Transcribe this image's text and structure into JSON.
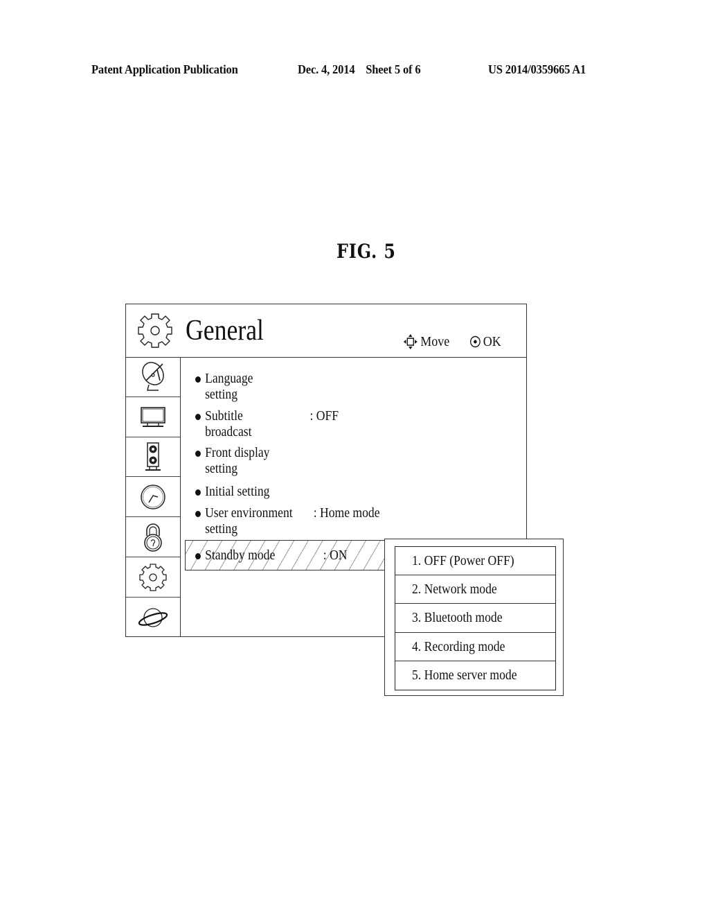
{
  "header": {
    "publication": "Patent Application Publication",
    "date_sheet": "Dec. 4, 2014    Sheet 5 of 6",
    "patent_number": "US 2014/0359665 A1"
  },
  "figure": {
    "label": "FIG. 5"
  },
  "settings_menu": {
    "title": "General",
    "title_icon": "gear-icon",
    "hints": [
      {
        "icon": "four-way-arrow-icon",
        "label": "Move"
      },
      {
        "icon": "ok-circle-icon",
        "label": "OK"
      }
    ],
    "sidebar": [
      {
        "icon": "satellite-dish-icon",
        "name": "broadcast"
      },
      {
        "icon": "tv-monitor-icon",
        "name": "picture"
      },
      {
        "icon": "speaker-icon",
        "name": "audio"
      },
      {
        "icon": "clock-icon",
        "name": "time"
      },
      {
        "icon": "padlock-icon",
        "name": "lock"
      },
      {
        "icon": "gear-icon",
        "name": "general"
      },
      {
        "icon": "planet-icon",
        "name": "network"
      }
    ],
    "items": [
      {
        "label_line1": "Language",
        "label_line2": "setting",
        "value": ""
      },
      {
        "label_line1": "Subtitle",
        "label_line2": "broadcast",
        "value": ":  OFF"
      },
      {
        "label_line1": "Front display",
        "label_line2": "setting",
        "value": ""
      },
      {
        "label_line1": "Initial setting",
        "label_line2": "",
        "value": ""
      },
      {
        "label_line1": "User environment",
        "label_line2": "setting",
        "value": ": Home mode"
      }
    ],
    "selected_item": {
      "label": "Standby mode",
      "value": ":  ON"
    }
  },
  "standby_popup": {
    "options": [
      "1. OFF (Power OFF)",
      "2. Network mode",
      "3. Bluetooth mode",
      "4. Recording mode",
      "5. Home server mode"
    ]
  }
}
